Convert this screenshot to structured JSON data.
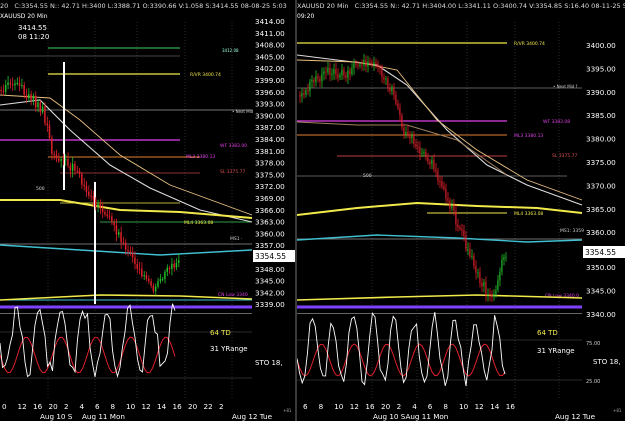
{
  "left_chart": {
    "header_open_time": "20",
    "header_info": "C:3354.55  N:: 42.71  H:3400  L:3388.71  O:3390.66  V:1.058  S:3414.55  08-08-25  5:03",
    "header_symbol": "XAUUSD 20 Min",
    "price_label_top": "3414.55",
    "price_label_time": "08 11:20",
    "level_labels": {
      "top_label": "3412.08",
      "r1": "R/VR  3400.74",
      "nextme": "• Next Mid",
      "wf": "WF  3383.00",
      "ml3": "ML3  3380.13",
      "sl": "SL  3375.77",
      "ml4": "ML4  3363.08",
      "ms1": "MS1 ·",
      "cnlow": "CN Low  3340",
      "five_hundred": "500"
    },
    "current_price": "3354.55",
    "y_ticks": [
      "3414.00",
      "3411.00",
      "3408.00",
      "3405.00",
      "3402.00",
      "3399.00",
      "3396.00",
      "3393.00",
      "3390.00",
      "3387.00",
      "3384.00",
      "3381.00",
      "3378.00",
      "3375.00",
      "3372.00",
      "3369.00",
      "3366.00",
      "3363.00",
      "3360.00",
      "3357.00",
      "3351.00",
      "3348.00",
      "3345.00",
      "3342.00",
      "3339.00"
    ],
    "td_label": "64 TD",
    "yrange_label": "31 YRange",
    "sto_label": "STO 18,",
    "x_ticks": [
      "0",
      "12",
      "16",
      "20",
      "2",
      "4",
      "6",
      "8",
      "10",
      "12",
      "14",
      "16",
      "20",
      "22",
      "2"
    ],
    "date_labels": [
      "Aug 10 S",
      "Aug 11 Mon",
      "Aug 12 Tue"
    ],
    "bottom_right": "+81"
  },
  "right_chart": {
    "header_open_time": "09:20",
    "header_info": "C:3354.55  N:: 42.71  H:3404.00  L:3341.11  O:3400.74  V:3354.85  S:16.40  08-11-25  5:03",
    "header_symbol": "XAUUSD 20 Min",
    "level_labels": {
      "r1": "R/VR  3400.74",
      "nextme": "• Next Mid f",
      "wf": "WF  3383.08",
      "ml3": "ML3  3380.13",
      "sl": "SL  3375.77",
      "ml4": "ML4  3363.08",
      "ms1": "MS1: 3359",
      "cnlow": "CN Low  3340.0",
      "five_hundred": "500"
    },
    "current_price": "3354.55",
    "y_ticks": [
      "3400.00",
      "3395.00",
      "3390.00",
      "3385.00",
      "3380.00",
      "3375.00",
      "3370.00",
      "3365.00",
      "3360.00",
      "3350.00",
      "3345.00",
      "3340.00"
    ],
    "td_label": "64 TD",
    "yrange_label": "31 YRange",
    "sto_label": "STO 18,",
    "osc_ticks": [
      "75.00",
      "25.00"
    ],
    "x_ticks": [
      "6",
      "8",
      "10",
      "12",
      "16",
      "20",
      "2",
      "4",
      "6",
      "8",
      "10",
      "12",
      "14",
      "16"
    ],
    "date_labels": [
      "Aug 10 SAug 11 Mon",
      "Aug 12 Tue"
    ],
    "bottom_right": "+81"
  },
  "colors": {
    "background": "#000000",
    "bull": "#22c02a",
    "bear": "#e0202a",
    "yellow_level": "#f2ea4a",
    "magenta_level": "#e040e8",
    "orange_level": "#e08030",
    "purple_floor": "#8040ff",
    "cyan_ma": "#40c0d0",
    "white_ma": "#e8e8e8",
    "green_level": "#40d060"
  }
}
